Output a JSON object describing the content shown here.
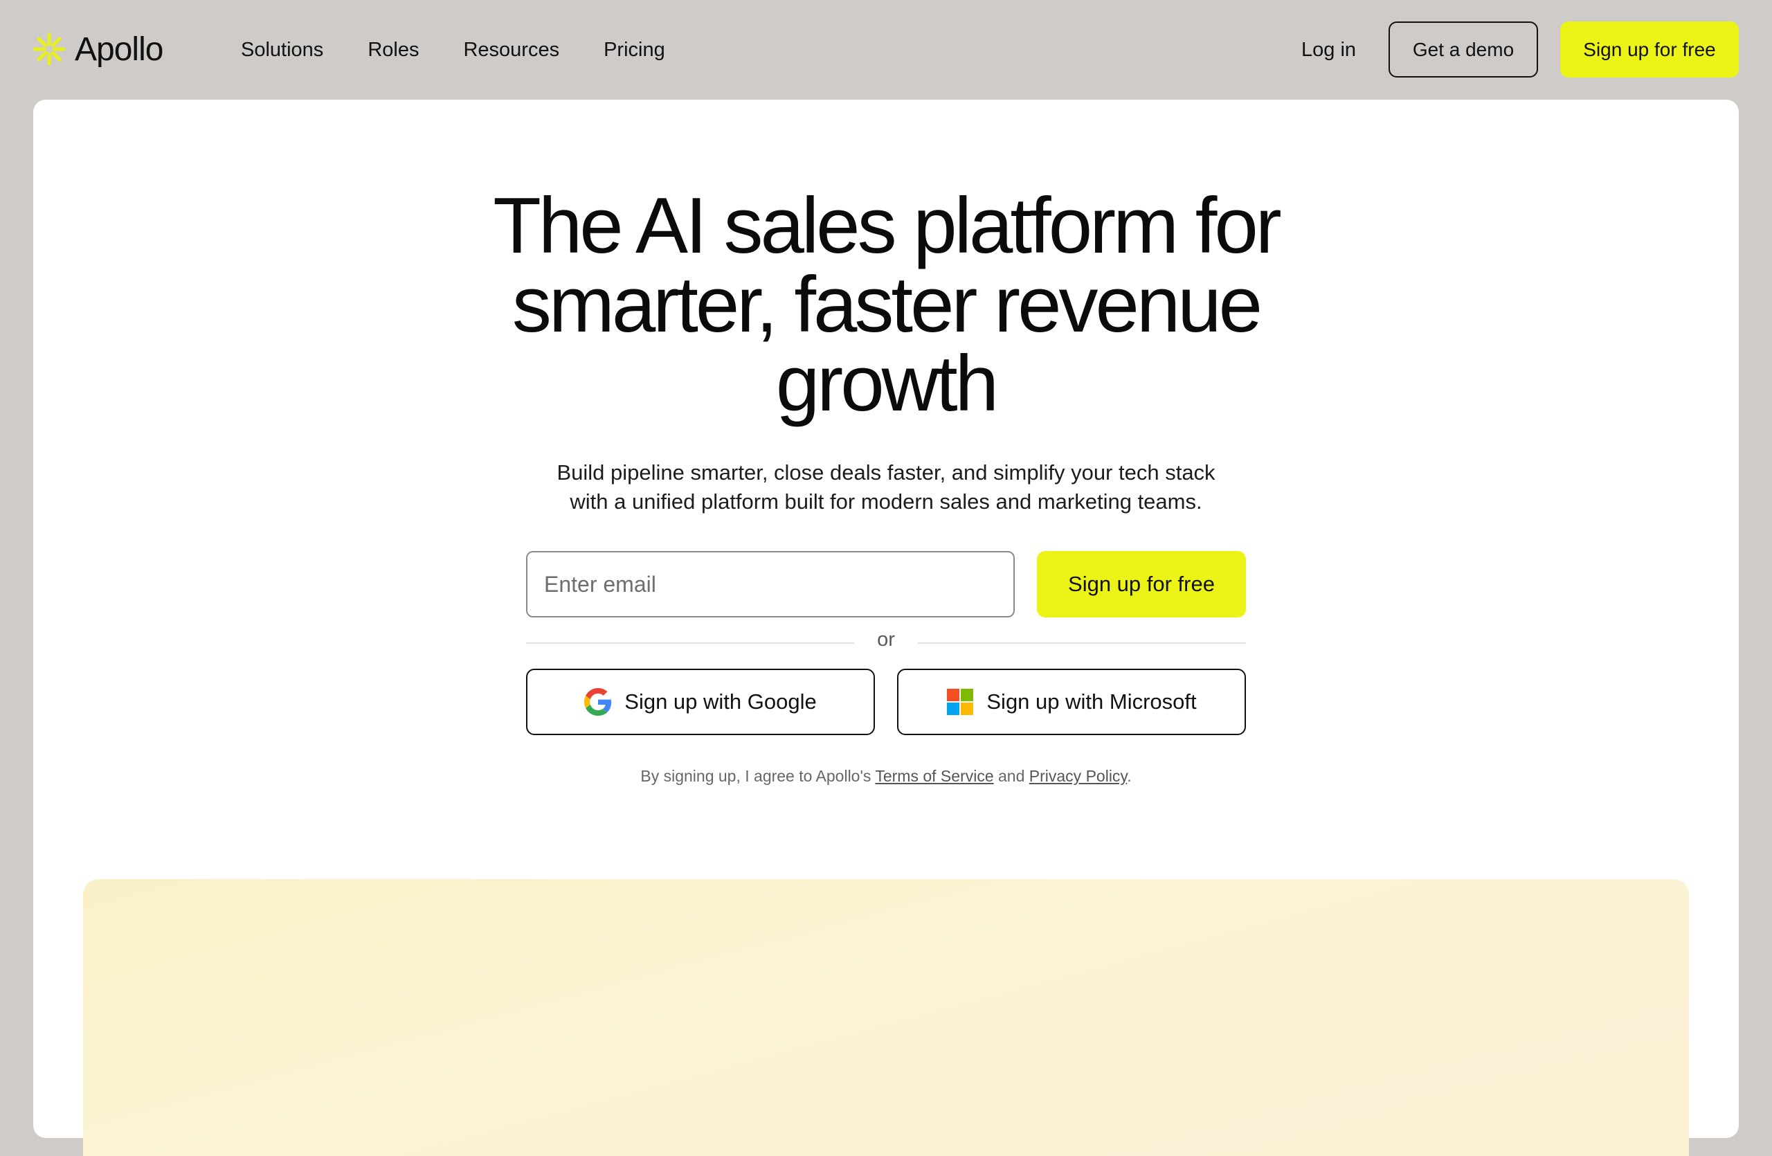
{
  "brand": {
    "name": "Apollo",
    "accent_color": "#ebf317"
  },
  "nav": {
    "links": [
      "Solutions",
      "Roles",
      "Resources",
      "Pricing"
    ],
    "login_label": "Log in",
    "demo_label": "Get a demo",
    "signup_label": "Sign up for free"
  },
  "hero": {
    "headline": [
      "The AI sales platform for",
      "smarter, faster revenue",
      "growth"
    ],
    "subtext": [
      "Build pipeline smarter, close deals faster, and simplify your tech stack",
      "with a unified platform built for modern sales and marketing teams."
    ],
    "email_placeholder": "Enter email",
    "email_value": "",
    "signup_button": "Sign up for free",
    "divider_text": "or",
    "google_button": "Sign up with Google",
    "microsoft_button": "Sign up with Microsoft",
    "legal": {
      "prefix": "By signing up, I agree to Apollo's ",
      "terms": "Terms of Service",
      "middle": " and ",
      "privacy": "Privacy Policy",
      "suffix": "."
    }
  },
  "icons": {
    "logo": "apollo-sunburst-icon",
    "google": "google-g-icon",
    "microsoft": "microsoft-logo-icon"
  }
}
